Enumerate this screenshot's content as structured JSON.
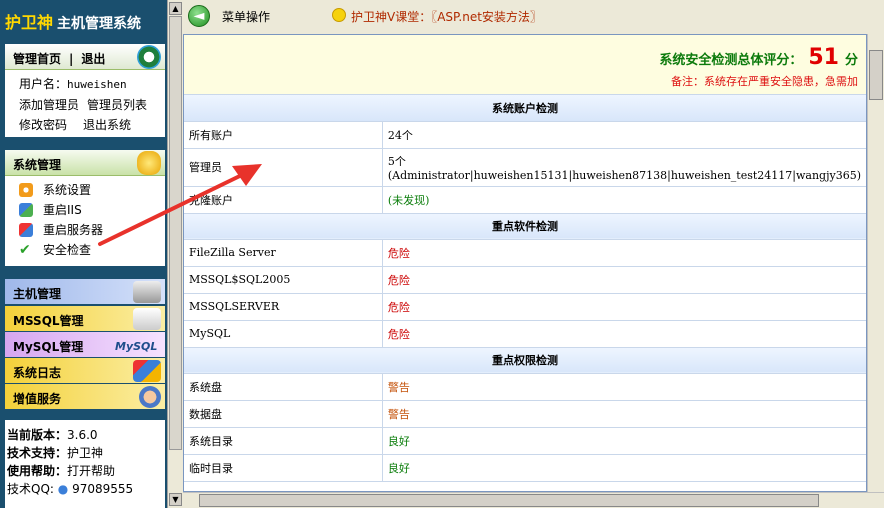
{
  "brand": {
    "logo": "护卫神",
    "title": "主机管理系统"
  },
  "user_panel": {
    "home_label": "管理首页",
    "sep": "|",
    "logout_label": "退出",
    "username_label": "用户名：",
    "username": "huweishen",
    "add_admin": "添加管理员",
    "admin_list": "管理员列表",
    "change_pwd": "修改密码",
    "exit_label": "退出系统"
  },
  "system_panel": {
    "title": "系统管理",
    "items": [
      "系统设置",
      "重启IIS",
      "重启服务器",
      "安全检查"
    ]
  },
  "menu_bars": {
    "host": "主机管理",
    "mssql": "MSSQL管理",
    "mysql": "MySQL管理",
    "mysql_logo": "MySQL",
    "log": "系统日志",
    "vas": "增值服务"
  },
  "info": {
    "version_label": "当前版本：",
    "version": "3.6.0",
    "support_label": "技术支持：",
    "support": "护卫神",
    "help_label": "使用帮助：",
    "help": "打开帮助",
    "qq_label": "技术QQ:",
    "qq": "97089555"
  },
  "topbar": {
    "back_icon": "arrow-left-icon",
    "menu_op": "菜单操作",
    "course": "护卫神V课堂：〖ASP.net安装方法〗"
  },
  "report": {
    "score_label": "系统安全检测总体评分：",
    "score": "51",
    "score_unit": "分",
    "note": "备注：系统存在严重安全隐患，急需加",
    "sections": [
      {
        "title": "系统账户检测",
        "rows": [
          {
            "k": "所有账户",
            "v": "24个",
            "status": "normal"
          },
          {
            "k": "管理员",
            "v": "5个(Administrator|huweishen15131|huweishen87138|huweishen_test24117|wangjy365)",
            "status": "normal"
          },
          {
            "k": "克隆账户",
            "v": "(未发现)",
            "status": "good"
          }
        ]
      },
      {
        "title": "重点软件检测",
        "rows": [
          {
            "k": "FileZilla Server",
            "v": "危险",
            "status": "danger"
          },
          {
            "k": "MSSQL$SQL2005",
            "v": "危险",
            "status": "danger"
          },
          {
            "k": "MSSQLSERVER",
            "v": "危险",
            "status": "danger"
          },
          {
            "k": "MySQL",
            "v": "危险",
            "status": "danger"
          }
        ]
      },
      {
        "title": "重点权限检测",
        "rows": [
          {
            "k": "系统盘",
            "v": "警告",
            "status": "warn"
          },
          {
            "k": "数据盘",
            "v": "警告",
            "status": "warn"
          },
          {
            "k": "系统目录",
            "v": "良好",
            "status": "good"
          },
          {
            "k": "临时目录",
            "v": "良好",
            "status": "good"
          }
        ]
      }
    ]
  },
  "colors": {
    "danger": "#cc0000",
    "warn": "#c4520a",
    "good": "#0a7d0a",
    "arrow": "#e8322b"
  }
}
